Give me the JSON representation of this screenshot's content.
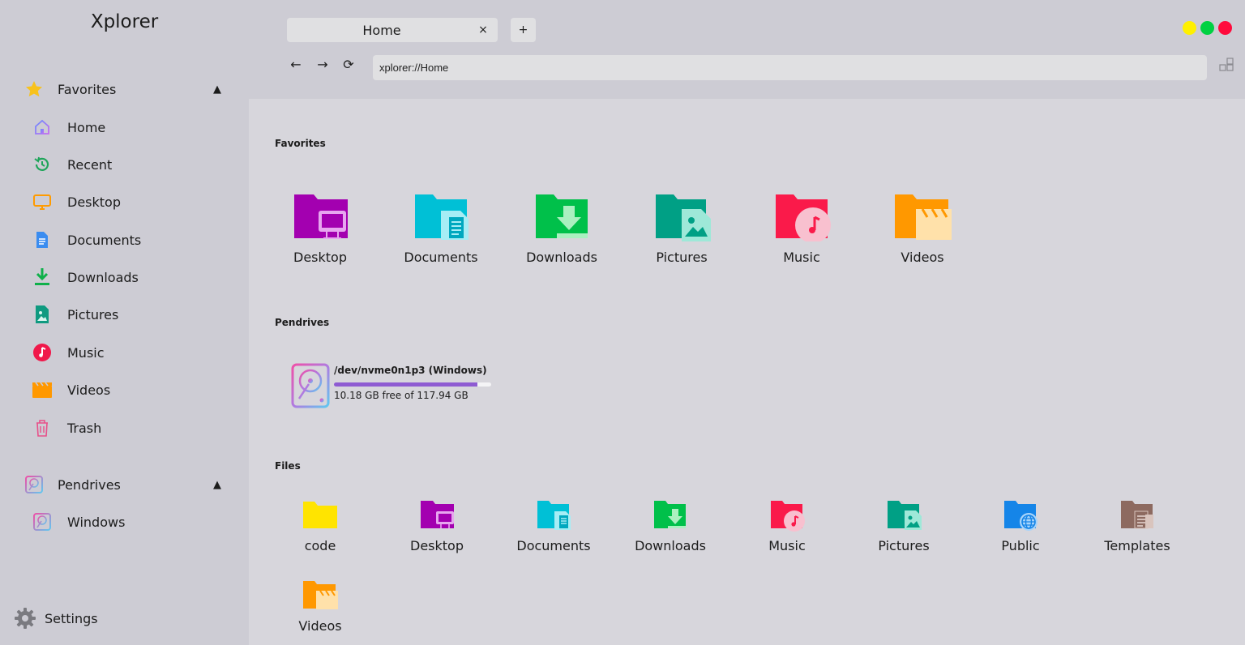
{
  "app": {
    "title": "Xplorer"
  },
  "sidebar": {
    "favorites_label": "Favorites",
    "favorites_arrow": "▲",
    "items": [
      {
        "label": "Home",
        "icon": "home-icon"
      },
      {
        "label": "Recent",
        "icon": "recent-icon"
      },
      {
        "label": "Desktop",
        "icon": "desktop-icon"
      },
      {
        "label": "Documents",
        "icon": "documents-icon"
      },
      {
        "label": "Downloads",
        "icon": "downloads-icon"
      },
      {
        "label": "Pictures",
        "icon": "pictures-icon"
      },
      {
        "label": "Music",
        "icon": "music-icon"
      },
      {
        "label": "Videos",
        "icon": "videos-icon"
      },
      {
        "label": "Trash",
        "icon": "trash-icon"
      }
    ],
    "pendrives_label": "Pendrives",
    "pendrives_arrow": "▲",
    "drives": [
      {
        "label": "Windows",
        "icon": "drive-icon"
      }
    ],
    "settings_label": "Settings"
  },
  "tabs": [
    {
      "label": "Home",
      "close": "×"
    }
  ],
  "new_tab_label": "+",
  "nav": {
    "back": "←",
    "forward": "→",
    "reload": "⟳"
  },
  "address": {
    "value": "xplorer://Home"
  },
  "window_controls": {
    "minimize": "#fff000",
    "maximize": "#00d142",
    "close": "#ff0a3c"
  },
  "main": {
    "favorites_title": "Favorites",
    "favorites": [
      {
        "label": "Desktop",
        "icon": "desktop-folder-icon",
        "color": "#a300b0"
      },
      {
        "label": "Documents",
        "icon": "documents-folder-icon",
        "color": "#00c0d6"
      },
      {
        "label": "Downloads",
        "icon": "downloads-folder-icon",
        "color": "#00c04a"
      },
      {
        "label": "Pictures",
        "icon": "pictures-folder-icon",
        "color": "#00a085"
      },
      {
        "label": "Music",
        "icon": "music-folder-icon",
        "color": "#fa1a4a"
      },
      {
        "label": "Videos",
        "icon": "videos-folder-icon",
        "color": "#ff9800"
      }
    ],
    "pendrives_title": "Pendrives",
    "drive": {
      "name": "/dev/nvme0n1p3 (Windows)",
      "free_text": "10.18 GB free of 117.94 GB",
      "used_fraction": 0.914
    },
    "files_title": "Files",
    "files": [
      {
        "label": "code",
        "icon": "folder-icon",
        "color": "#ffe400"
      },
      {
        "label": "Desktop",
        "icon": "desktop-folder-icon",
        "color": "#a300b0"
      },
      {
        "label": "Documents",
        "icon": "documents-folder-icon",
        "color": "#00c0d6"
      },
      {
        "label": "Downloads",
        "icon": "downloads-folder-icon",
        "color": "#00c04a"
      },
      {
        "label": "Music",
        "icon": "music-folder-icon",
        "color": "#fa1a4a"
      },
      {
        "label": "Pictures",
        "icon": "pictures-folder-icon",
        "color": "#00a085"
      },
      {
        "label": "Public",
        "icon": "public-folder-icon",
        "color": "#1585e8"
      },
      {
        "label": "Templates",
        "icon": "templates-folder-icon",
        "color": "#8d6a60"
      },
      {
        "label": "Videos",
        "icon": "videos-folder-icon",
        "color": "#ff9800"
      }
    ]
  }
}
